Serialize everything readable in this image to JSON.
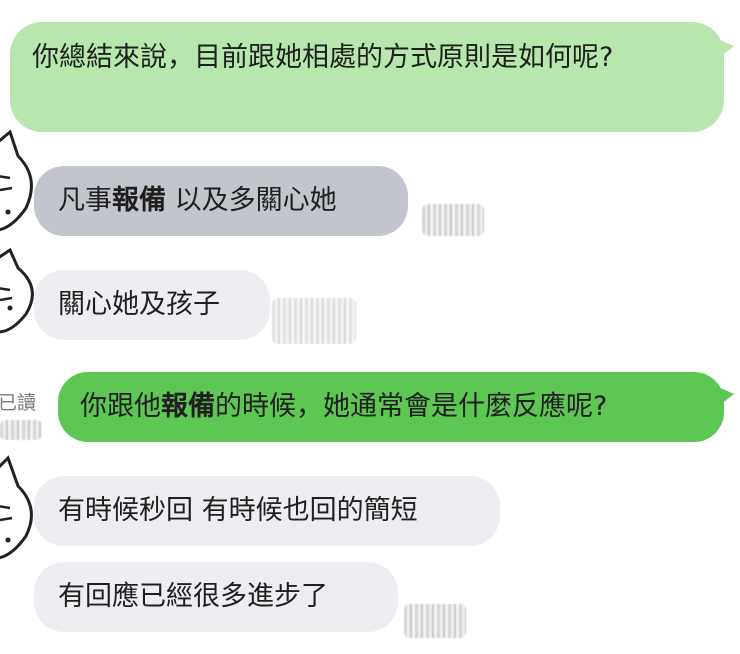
{
  "messages": [
    {
      "id": "m1",
      "sender": "me",
      "text": "你總結來說，目前跟她相處的方式原則是如何呢?"
    },
    {
      "id": "m2",
      "sender": "other",
      "pre": "凡事",
      "bold": "報備",
      "post": " 以及多關心她"
    },
    {
      "id": "m3",
      "sender": "other",
      "text": "關心她及孩子"
    },
    {
      "id": "m4",
      "sender": "me",
      "pre": "你跟他",
      "bold": "報備",
      "post": "的時候，她通常會是什麼反應呢?"
    },
    {
      "id": "m5",
      "sender": "other",
      "text": "有時候秒回 有時候也回的簡短"
    },
    {
      "id": "m6",
      "sender": "other",
      "text": "有回應已經很多進步了"
    }
  ],
  "read_receipt": "已讀",
  "colors": {
    "bubble_me_light": "#b7e7ac",
    "bubble_me_dark": "#5ec653",
    "bubble_other_grey": "#c2c6cc",
    "bubble_other_light": "#edeef1"
  },
  "avatar_icon": "cat-doodle-icon"
}
